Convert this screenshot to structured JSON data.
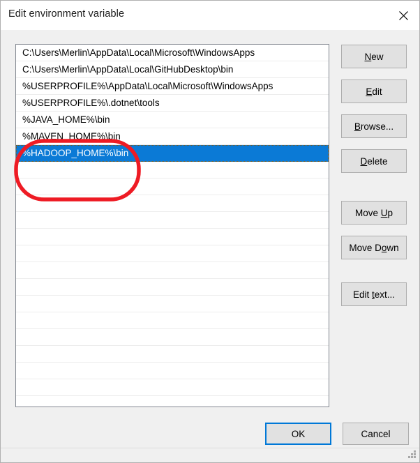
{
  "window": {
    "title": "Edit environment variable",
    "close_icon": "close-icon"
  },
  "list": {
    "items": [
      {
        "value": "C:\\Users\\Merlin\\AppData\\Local\\Microsoft\\WindowsApps",
        "selected": false
      },
      {
        "value": "C:\\Users\\Merlin\\AppData\\Local\\GitHubDesktop\\bin",
        "selected": false
      },
      {
        "value": "%USERPROFILE%\\AppData\\Local\\Microsoft\\WindowsApps",
        "selected": false
      },
      {
        "value": "%USERPROFILE%\\.dotnet\\tools",
        "selected": false
      },
      {
        "value": "%JAVA_HOME%\\bin",
        "selected": false
      },
      {
        "value": "%MAVEN_HOME%\\bin",
        "selected": false
      },
      {
        "value": "%HADOOP_HOME%\\bin",
        "selected": true
      }
    ],
    "empty_row_count": 14,
    "selection_color": "#0b7ad6"
  },
  "side_buttons": [
    {
      "label": "New",
      "accel": "N",
      "name": "new-button"
    },
    {
      "label": "Edit",
      "accel": "E",
      "name": "edit-button"
    },
    {
      "label": "Browse...",
      "accel": "B",
      "name": "browse-button"
    },
    {
      "label": "Delete",
      "accel": "D",
      "name": "delete-button"
    },
    {
      "label": "Move Up",
      "accel": "U",
      "name": "move-up-button"
    },
    {
      "label": "Move Down",
      "accel": "o",
      "name": "move-down-button"
    },
    {
      "label": "Edit text...",
      "accel": "t",
      "name": "edit-text-button"
    }
  ],
  "bottom_buttons": {
    "ok": "OK",
    "cancel": "Cancel"
  },
  "annotation": {
    "shape": "rounded-rectangle-highlight",
    "color": "#ee1b24",
    "stroke_width": 5,
    "highlights": [
      "%JAVA_HOME%\\bin",
      "%MAVEN_HOME%\\bin",
      "%HADOOP_HOME%\\bin"
    ]
  }
}
